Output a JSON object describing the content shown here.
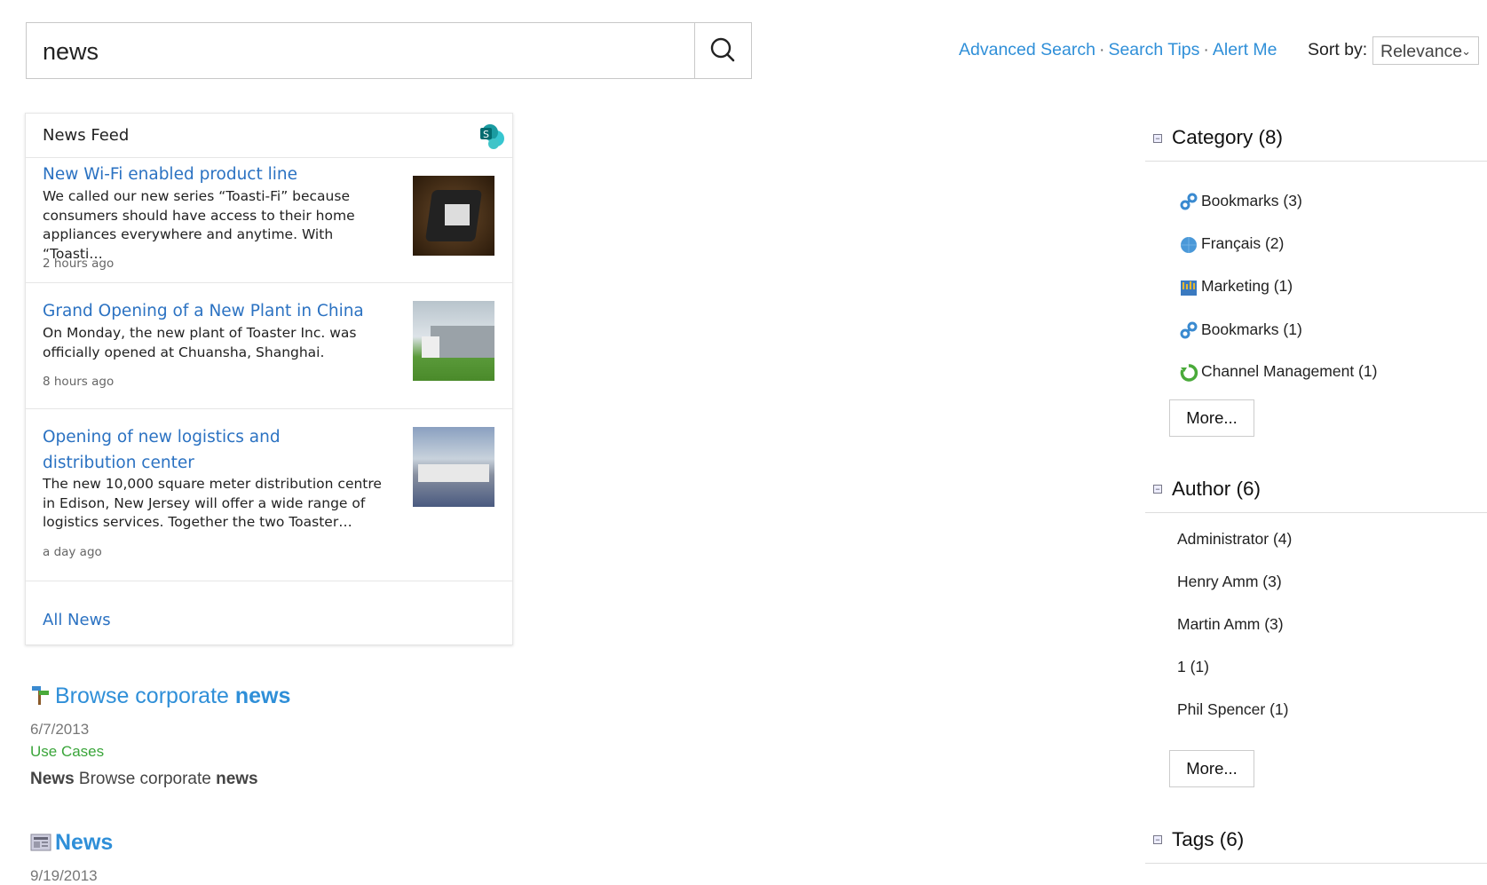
{
  "search": {
    "query": "news"
  },
  "links": {
    "advanced": "Advanced Search",
    "tips": "Search Tips",
    "alert": "Alert Me",
    "sep": "·"
  },
  "sort": {
    "label": "Sort by:",
    "value": "Relevance"
  },
  "news_feed": {
    "title": "News Feed",
    "items": [
      {
        "title": "New Wi-Fi enabled product line",
        "desc": "We called our new series “Toasti-Fi” because consumers should have access to their home appliances everywhere and anytime. With “Toasti…",
        "time": "2 hours ago"
      },
      {
        "title": "Grand Opening of a New Plant in China",
        "desc": "On Monday, the new plant of Toaster Inc. was officially opened at Chuansha, Shanghai.",
        "time": "8 hours ago"
      },
      {
        "title": "Opening of new logistics and distribution center",
        "desc": "The new 10,000 square meter distribution centre in Edison, New Jersey will offer a wide range of logistics services. Together the two Toaster…",
        "time": "a day ago"
      }
    ],
    "all_link": "All News"
  },
  "results": [
    {
      "title_pre": "Browse corporate ",
      "title_bold": "news",
      "date": "6/7/2013",
      "category": "Use Cases",
      "snip_b1": "News",
      "snip_mid": " Browse corporate ",
      "snip_b2": "news"
    },
    {
      "title_bold": "News",
      "date": "9/19/2013"
    }
  ],
  "facets": {
    "category": {
      "title": "Category (8)",
      "items": [
        {
          "label": "Bookmarks (3)",
          "icon": "link-icon"
        },
        {
          "label": "Français (2)",
          "icon": "globe-icon"
        },
        {
          "label": "Marketing (1)",
          "icon": "chart-icon"
        },
        {
          "label": "Bookmarks (1)",
          "icon": "link-icon"
        },
        {
          "label": "Channel Management (1)",
          "icon": "recycle-icon"
        }
      ],
      "more": "More..."
    },
    "author": {
      "title": "Author (6)",
      "items": [
        "Administrator (4)",
        "Henry Amm (3)",
        "Martin Amm (3)",
        "1 (1)",
        "Phil Spencer (1)"
      ],
      "more": "More..."
    },
    "tags": {
      "title": "Tags (6)"
    }
  },
  "colors": {
    "link": "#2f8fd8",
    "feed_link": "#2b72c2",
    "category": "#3aa53a"
  }
}
